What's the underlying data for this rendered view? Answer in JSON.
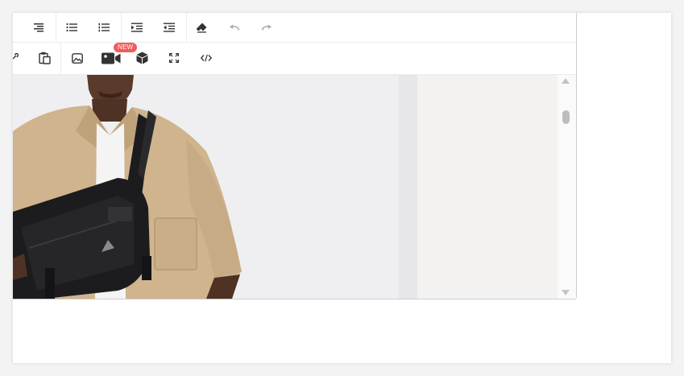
{
  "toolbar": {
    "row1": [
      {
        "icon": "align-right-icon"
      },
      {
        "icon": "bulleted-list-icon"
      },
      {
        "icon": "numbered-list-icon"
      },
      {
        "icon": "indent-icon"
      },
      {
        "icon": "outdent-icon"
      },
      {
        "icon": "clear-format-icon"
      },
      {
        "icon": "undo-icon"
      },
      {
        "icon": "redo-icon"
      }
    ],
    "row2": [
      {
        "icon": "link-icon"
      },
      {
        "icon": "paste-icon"
      },
      {
        "icon": "image-icon"
      },
      {
        "icon": "video-icon"
      },
      {
        "icon": "3d-model-icon"
      },
      {
        "icon": "fullscreen-icon"
      },
      {
        "icon": "source-code-icon"
      }
    ],
    "new_badge": "NEW"
  },
  "colors": {
    "icon": "#333333",
    "icon_disabled": "#a9a9ad",
    "badge": "#f25b5b",
    "shirt": "#cfb48e",
    "bag": "#1c1c1e",
    "skin": "#5a3a2a"
  }
}
